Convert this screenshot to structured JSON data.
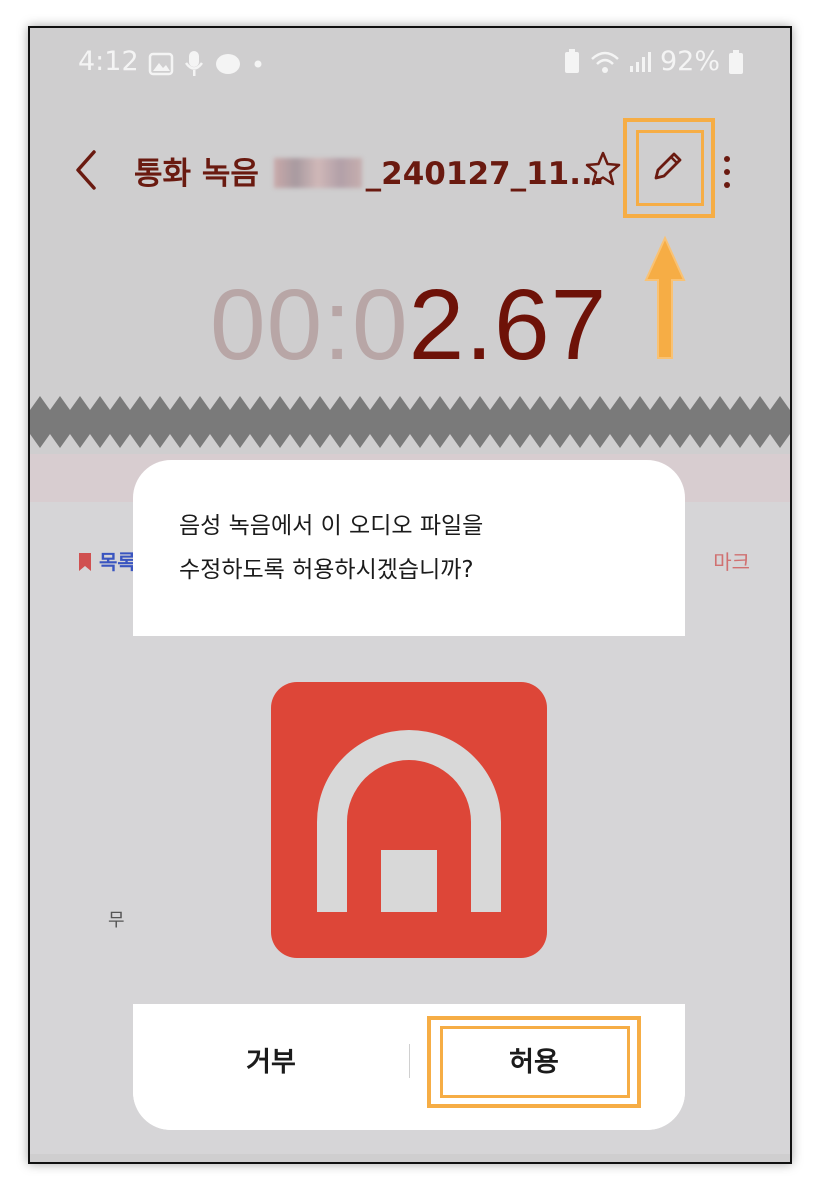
{
  "status_bar": {
    "time": "4:12",
    "battery": "92%"
  },
  "toolbar": {
    "title_prefix": "통화 녹음",
    "title_suffix": "_240127_11..."
  },
  "player": {
    "time_dim": "00:0",
    "time_main": "2.67"
  },
  "background": {
    "bookmark_left": "목록",
    "bookmark_right": "마크",
    "left_label": "무"
  },
  "dialog": {
    "message_line1": "음성 녹음에서 이 오디오 파일을",
    "message_line2": "수정하도록 허용하시겠습니까?",
    "deny_label": "거부",
    "allow_label": "허용"
  },
  "colors": {
    "highlight": "#f6ad45",
    "title": "#6a1a10",
    "app_icon_bg": "#dd4638"
  }
}
